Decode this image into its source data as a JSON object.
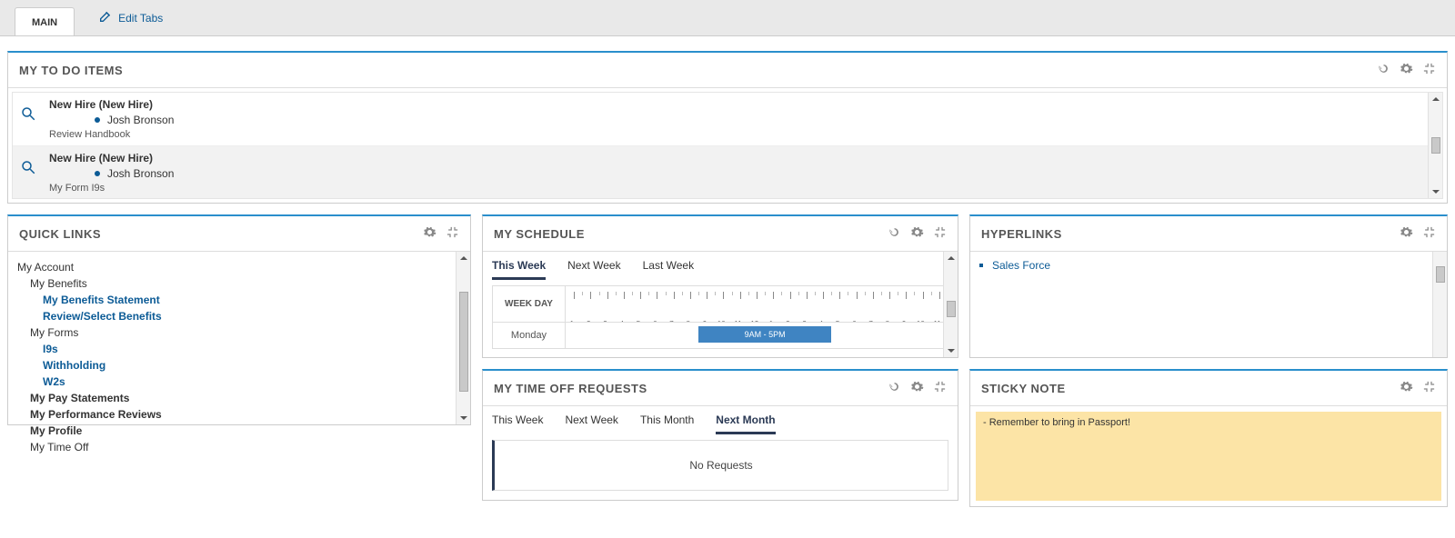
{
  "tabs": {
    "main": "MAIN",
    "edit": "Edit Tabs"
  },
  "todo": {
    "title": "MY TO DO ITEMS",
    "items": [
      {
        "title": "New Hire (New Hire)",
        "person": "Josh Bronson",
        "desc": "Review Handbook"
      },
      {
        "title": "New Hire (New Hire)",
        "person": "Josh Bronson",
        "desc": "My Form I9s"
      }
    ]
  },
  "quicklinks": {
    "title": "QUICK LINKS",
    "tree": {
      "root": "My Account",
      "benefits_group": "My Benefits",
      "benefits_statement": "My Benefits Statement",
      "benefits_select": "Review/Select Benefits",
      "forms_group": "My Forms",
      "i9s": "I9s",
      "withholding": "Withholding",
      "w2s": "W2s",
      "pay": "My Pay Statements",
      "perf": "My Performance Reviews",
      "profile": "My Profile",
      "timeoff": "My Time Off"
    }
  },
  "schedule": {
    "title": "MY SCHEDULE",
    "tabs": {
      "this": "This Week",
      "next": "Next Week",
      "last": "Last Week"
    },
    "header": "WEEK DAY",
    "hours": [
      "1a",
      "2a",
      "3a",
      "4a",
      "5a",
      "6a",
      "7a",
      "8a",
      "9a",
      "10a",
      "11a",
      "12p",
      "1p",
      "2p",
      "3p",
      "4p",
      "5p",
      "6p",
      "7p",
      "8p",
      "9p",
      "10p",
      "11p"
    ],
    "row1_day": "Monday",
    "row1_shift": "9AM - 5PM"
  },
  "timeoff": {
    "title": "MY TIME OFF REQUESTS",
    "tabs": {
      "tw": "This Week",
      "nw": "Next Week",
      "tm": "This Month",
      "nm": "Next Month"
    },
    "empty": "No Requests"
  },
  "hyperlinks": {
    "title": "HYPERLINKS",
    "items": [
      "Sales Force"
    ]
  },
  "sticky": {
    "title": "STICKY NOTE",
    "text": "- Remember to bring in Passport!"
  }
}
